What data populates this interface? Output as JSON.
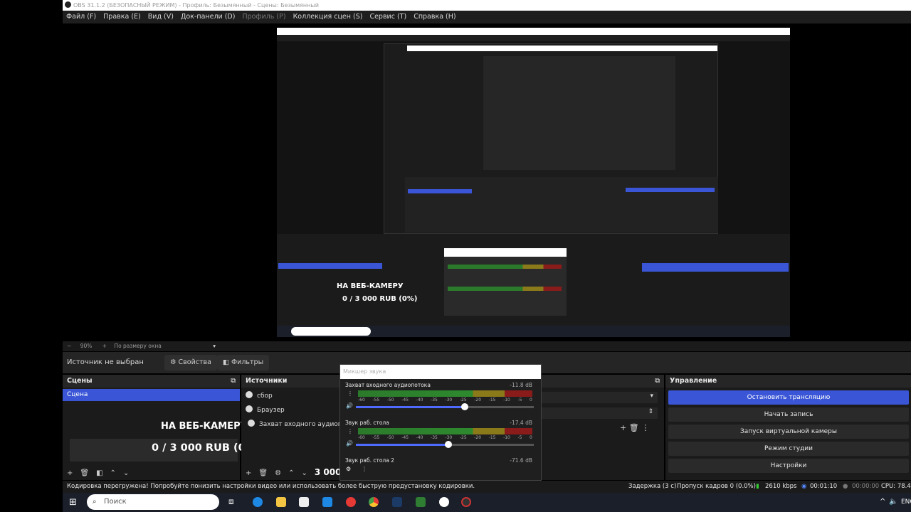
{
  "window": {
    "title": "OBS 31.1.2 (БЕЗОПАСНЫЙ РЕЖИМ) - Профиль: Безымянный - Сцены: Безымянный"
  },
  "menu": [
    {
      "label": "Файл (F)",
      "dim": false
    },
    {
      "label": "Правка (E)",
      "dim": false
    },
    {
      "label": "Вид (V)",
      "dim": false
    },
    {
      "label": "Док-панели (D)",
      "dim": false
    },
    {
      "label": "Профиль (P)",
      "dim": true
    },
    {
      "label": "Коллекция сцен (S)",
      "dim": false
    },
    {
      "label": "Сервис (T)",
      "dim": false
    },
    {
      "label": "Справка (H)",
      "dim": false
    }
  ],
  "zoom": {
    "minus": "−",
    "value": "90%",
    "plus": "+",
    "fit_label": "По размеру окна"
  },
  "source_toolbar": {
    "no_source": "Источник не выбран",
    "properties": "Свойства",
    "filters": "Фильтры"
  },
  "scenes": {
    "title": "Сцены",
    "items": [
      "Сцена"
    ]
  },
  "sources": {
    "title": "Источники",
    "items": [
      "сбор",
      "Браузер",
      "Захват входного аудиопото"
    ]
  },
  "overlay": {
    "webcam": "НА ВЕБ-КАМЕРУ",
    "goal": "0 / 3 000 RUB (0%)",
    "goal_partial": "3 000"
  },
  "mixer": {
    "title": "Микшер звука",
    "scale": [
      "-60",
      "-55",
      "-50",
      "-45",
      "-40",
      "-35",
      "-30",
      "-25",
      "-20",
      "-15",
      "-10",
      "-5",
      "0"
    ],
    "channels": [
      {
        "name": "Захват входного аудиопотока",
        "db": "-11.8 dB",
        "level": 0.61
      },
      {
        "name": "Звук раб. стола",
        "db": "-17.4 dB",
        "level": 0.52
      },
      {
        "name": "Звук раб. стола 2",
        "db": "-71.6 dB",
        "level": 0.0
      }
    ]
  },
  "controls": {
    "title": "Управление",
    "buttons": [
      "Остановить трансляцию",
      "Начать запись",
      "Запуск виртуальной камеры",
      "Режим студии",
      "Настройки"
    ]
  },
  "status": {
    "message": "Кодировка перегружена! Попробуйте понизить настройки видео или использовать более быструю предустановку кодировки.",
    "delay": "Задержка (3 с)",
    "dropped": "Пропуск кадров 0 (0.0%)",
    "bitrate": "2610 kbps",
    "stream_time": "00:01:10",
    "rec_time": "00:00:00",
    "cpu": "CPU: 78.4"
  },
  "taskbar": {
    "search_placeholder": "Поиск",
    "lang": "ENG"
  },
  "colors": {
    "accent": "#3a56d6",
    "background": "#1b1b1b"
  }
}
